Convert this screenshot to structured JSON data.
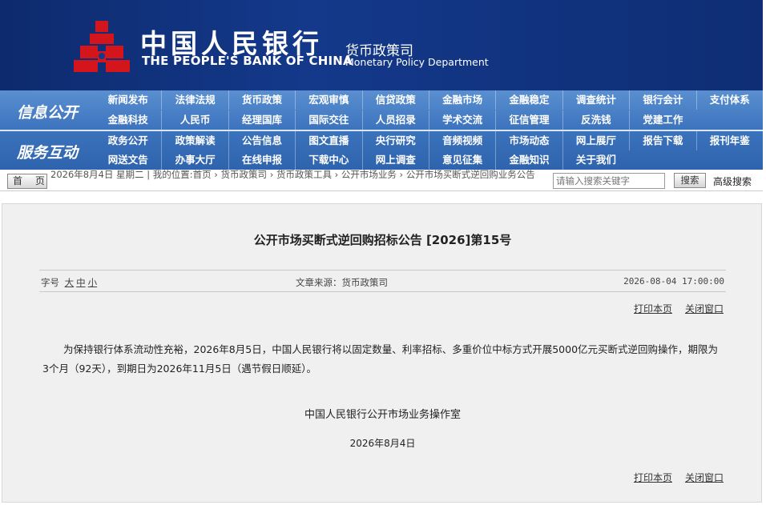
{
  "header": {
    "bank_name_cn": "中国人民银行",
    "bank_name_en": "THE PEOPLE'S BANK OF CHINA",
    "department_cn": "货币政策司",
    "department_en": "Monetary Policy Department",
    "logo_icon": "pboc-logo-icon",
    "colors": {
      "header_bg": "#14398a",
      "nav_bg": "#3c73bd",
      "logo_red": "#d4161c"
    }
  },
  "nav": {
    "section1_label": "信息公开",
    "section2_label": "服务互动",
    "row1": [
      "新闻发布",
      "法律法规",
      "货币政策",
      "宏观审慎",
      "信贷政策",
      "金融市场",
      "金融稳定",
      "调查统计",
      "银行会计",
      "支付体系"
    ],
    "row2": [
      "金融科技",
      "人民币",
      "经理国库",
      "国际交往",
      "人员招录",
      "学术交流",
      "征信管理",
      "反洗钱",
      "党建工作"
    ],
    "row3": [
      "政务公开",
      "政策解读",
      "公告信息",
      "图文直播",
      "央行研究",
      "音频视频",
      "市场动态",
      "网上展厅",
      "报告下载",
      "报刊年鉴"
    ],
    "row4": [
      "网送文告",
      "办事大厅",
      "在线申报",
      "下载中心",
      "网上调查",
      "意见征集",
      "金融知识",
      "关于我们"
    ]
  },
  "breadcrumb": {
    "home_label": "首 页",
    "date": "2026年8月4日 星期二",
    "location_label": "我的位置:",
    "items": [
      "首页",
      "货币政策司",
      "货币政策工具",
      "公开市场业务",
      "公开市场买断式逆回购业务公告"
    ],
    "search_placeholder": "请输入搜索关键字",
    "search_button": "搜索",
    "advanced_search": "高级搜索"
  },
  "article": {
    "title": "公开市场买断式逆回购招标公告 [2026]第15号",
    "font_size_label": "字号",
    "font_sizes": [
      "大",
      "中",
      "小"
    ],
    "source": "文章来源：货币政策司",
    "publish_time": "2026-08-04 17:00:00",
    "print_label": "打印本页",
    "close_label": "关闭窗口",
    "body": "为保持银行体系流动性充裕，2026年8月5日，中国人民银行将以固定数量、利率招标、多重价位中标方式开展5000亿元买断式逆回购操作，期限为3个月（92天），到期日为2026年11月5日（遇节假日顺延）。",
    "signer": "中国人民银行公开市场业务操作室",
    "sign_date": "2026年8月4日"
  }
}
